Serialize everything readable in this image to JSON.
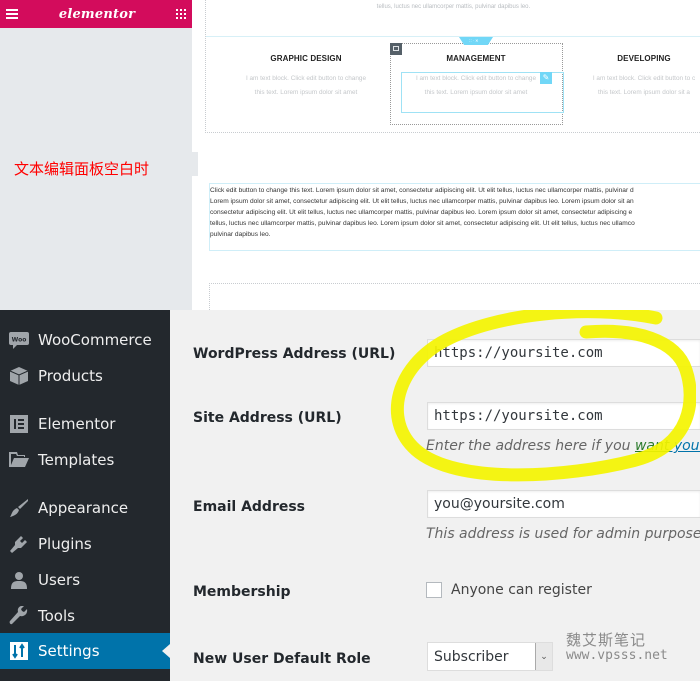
{
  "elementor": {
    "logo": "elementor",
    "menu_icon": "hamburger-icon",
    "apps_icon": "grid-icon",
    "panel_note": "文本编辑面板空白时",
    "canvas": {
      "top_text": "tellus, luctus nec ullamcorper mattis, pulvinar dapibus leo.",
      "section_tab": "∷ · ✕",
      "columns": [
        {
          "title": "GRAPHIC DESIGN",
          "line1": "I am text block. Click edit button to change",
          "line2": "this text. Lorem ipsum dolor sit amet"
        },
        {
          "title": "MANAGEMENT",
          "line1": "I am text block. Click edit button to change",
          "line2": "this text. Lorem ipsum dolor sit amet"
        },
        {
          "title": "DEVELOPING",
          "line1": "I am text block. Click edit button to c",
          "line2": "this text. Lorem ipsum dolor sit a"
        }
      ],
      "edit_icon": "✎",
      "paragraph_lines": [
        "Click edit button to change this text. Lorem ipsum dolor sit amet, consectetur adipiscing elit. Ut elit tellus, luctus nec ullamcorper mattis, pulvinar d",
        "Lorem ipsum dolor sit amet, consectetur adipiscing elit. Ut elit tellus, luctus nec ullamcorper mattis, pulvinar dapibus leo. Lorem ipsum dolor sit an",
        "consectetur adipiscing elit. Ut elit tellus, luctus nec ullamcorper mattis, pulvinar dapibus leo. Lorem ipsum dolor sit amet, consectetur adipiscing e",
        "tellus, luctus nec ullamcorper mattis, pulvinar dapibus leo. Lorem ipsum dolor sit amet, consectetur adipiscing elit. Ut elit tellus, luctus nec ullamco",
        "pulvinar dapibus leo."
      ]
    }
  },
  "wp": {
    "sidebar": {
      "items": [
        {
          "label": "WooCommerce",
          "icon": "woocommerce-icon"
        },
        {
          "label": "Products",
          "icon": "box-icon"
        },
        {
          "label": "Elementor",
          "icon": "elementor-icon"
        },
        {
          "label": "Templates",
          "icon": "folder-icon"
        },
        {
          "label": "Appearance",
          "icon": "paintbrush-icon"
        },
        {
          "label": "Plugins",
          "icon": "plug-icon"
        },
        {
          "label": "Users",
          "icon": "user-icon"
        },
        {
          "label": "Tools",
          "icon": "wrench-icon"
        },
        {
          "label": "Settings",
          "icon": "settings-icon",
          "active": true
        }
      ]
    },
    "form": {
      "wp_address_label": "WordPress Address (URL)",
      "wp_address_value": "https://yoursite.com",
      "site_address_label": "Site Address (URL)",
      "site_address_value": "https://yoursite.com",
      "site_address_desc": "Enter the address here if you ",
      "site_address_link1": "want",
      "site_address_link2": " your site",
      "email_label": "Email Address",
      "email_value": "you@yoursite.com",
      "email_desc": "This address is used for admin purposes. If y",
      "membership_label": "Membership",
      "membership_checkbox_label": "Anyone can register",
      "membership_checked": false,
      "role_label": "New User Default Role",
      "role_value": "Subscriber"
    },
    "colors": {
      "sidebar_bg": "#23282d",
      "active_bg": "#0073aa",
      "highlight": "#f5f500",
      "elementor_brand": "#d30c5c"
    }
  },
  "watermark": {
    "cn": "魏艾斯笔记",
    "url": "www.vpsss.net"
  }
}
